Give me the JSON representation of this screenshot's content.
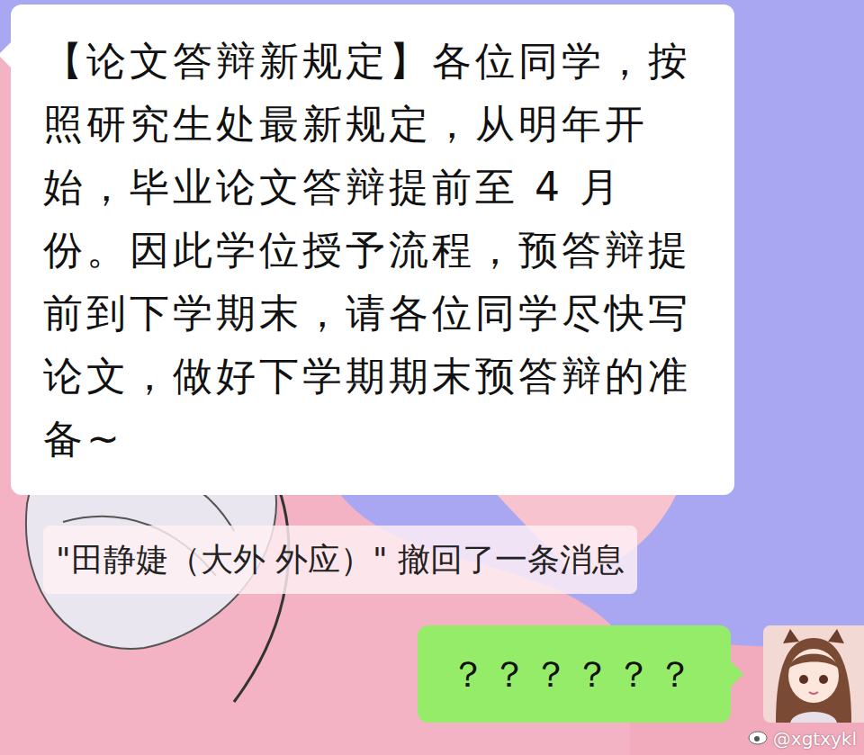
{
  "messages": [
    {
      "sender": "other",
      "text": "【论文答辩新规定】各位同学，按照研究生处最新规定，从明年开始，毕业论文答辩提前至 4 月份。因此学位授予流程，预答辩提前到下学期末，请各位同学尽快写论文，做好下学期期末预答辩的准备~"
    }
  ],
  "recall_notice": "\"田静婕（大外 外应）\" 撤回了一条消息",
  "my_message": "？？？？？？",
  "watermark": "@xgtxykl"
}
